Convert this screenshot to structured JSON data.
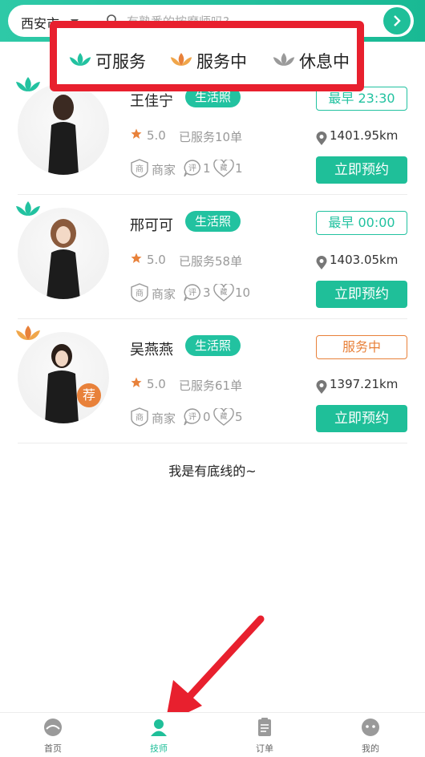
{
  "search": {
    "city": "西安市",
    "placeholder": "有熟悉的按摩师吗?"
  },
  "legend": {
    "items": [
      {
        "label": "可服务",
        "color": "#22c2a0"
      },
      {
        "label": "服务中",
        "color": "#e8813a"
      },
      {
        "label": "休息中",
        "color": "#9a9a9a"
      }
    ]
  },
  "therapists": [
    {
      "name": "王佳宁",
      "tag": "生活照",
      "rating": "5.0",
      "served": "已服务10单",
      "shop": "商家",
      "comments": "1",
      "favorites": "1",
      "time_label": "最早 23:30",
      "distance": "1401.95km",
      "book_label": "立即预约",
      "status": "可服务"
    },
    {
      "name": "邢可可",
      "tag": "生活照",
      "rating": "5.0",
      "served": "已服务58单",
      "shop": "商家",
      "comments": "3",
      "favorites": "10",
      "time_label": "最早 00:00",
      "distance": "1403.05km",
      "book_label": "立即预约",
      "status": "可服务"
    },
    {
      "name": "吴燕燕",
      "tag": "生活照",
      "rating": "5.0",
      "served": "已服务61单",
      "shop": "商家",
      "comments": "0",
      "favorites": "5",
      "time_label": "服务中",
      "distance": "1397.21km",
      "book_label": "立即预约",
      "status": "服务中",
      "recommend_badge": "荐"
    }
  ],
  "icon_letters": {
    "shop": "商",
    "comment": "评",
    "favorite": "藏"
  },
  "footer_note": "我是有底线的~",
  "tabs": [
    {
      "label": "首页",
      "icon": "home-icon"
    },
    {
      "label": "技师",
      "icon": "therapist-icon"
    },
    {
      "label": "订单",
      "icon": "order-icon"
    },
    {
      "label": "我的",
      "icon": "profile-icon"
    }
  ],
  "colors": {
    "accent": "#1fbf99",
    "busy": "#e8813a",
    "annotation": "#e8202e"
  }
}
